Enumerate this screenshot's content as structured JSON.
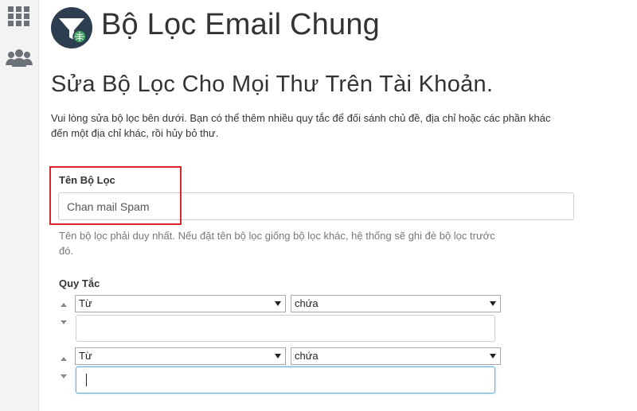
{
  "sidebar": {
    "items": [
      {
        "icon": "grid-icon"
      },
      {
        "icon": "users-icon"
      }
    ]
  },
  "header": {
    "title": "Bộ Lọc Email Chung",
    "logo_icon": "email-filter-icon"
  },
  "main": {
    "heading": "Sửa Bộ Lọc Cho Mọi Thư Trên Tài Khoản.",
    "description_line1": "Vui lòng sửa bộ lọc bên dưới. Bạn có thể thêm nhiều quy tắc để đối sánh chủ đề, địa chỉ hoặc các phần khác",
    "description_line2": "đến một địa chỉ khác, rồi hủy bỏ thư.",
    "filter_name": {
      "label": "Tên Bộ Lọc",
      "value": "Chan mail Spam",
      "help_line1": "Tên bộ lọc phải duy nhất. Nếu đặt tên bộ lọc giống bộ lọc khác, hệ thống sẽ ghi đè bộ lọc trước",
      "help_line2": "đó."
    },
    "rules": {
      "label": "Quy Tắc",
      "items": [
        {
          "field": "Từ",
          "operator": "chứa",
          "value": ""
        },
        {
          "field": "Từ",
          "operator": "chứa",
          "value": ""
        }
      ]
    }
  },
  "colors": {
    "highlight": "#d9262c",
    "focus": "#66afe9",
    "sidebar_bg": "#f3f3f3"
  }
}
